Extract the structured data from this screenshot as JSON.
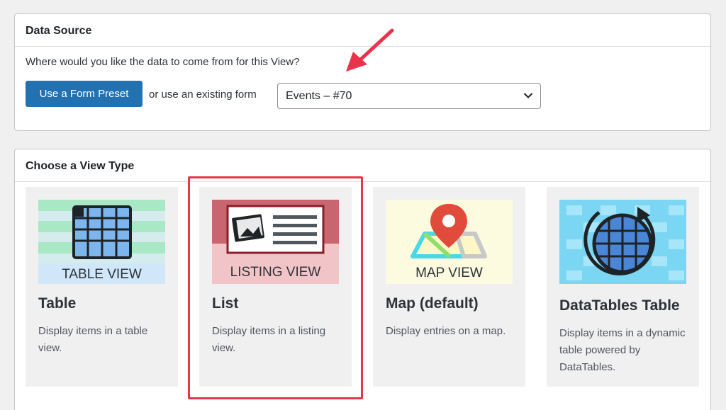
{
  "data_source": {
    "header": "Data Source",
    "question": "Where would you like the data to come from for this View?",
    "preset_button": "Use a Form Preset",
    "or_text": "or use an existing form",
    "selected_form": "Events – #70"
  },
  "view_type": {
    "header": "Choose a View Type",
    "cards": [
      {
        "title": "Table",
        "desc": "Display items in a table view.",
        "thumb_label": "TABLE VIEW"
      },
      {
        "title": "List",
        "desc": "Display items in a listing view.",
        "thumb_label": "LISTING VIEW"
      },
      {
        "title": "Map (default)",
        "desc": "Display entries on a map.",
        "thumb_label": "MAP VIEW"
      },
      {
        "title": "DataTables Table",
        "desc": "Display items in a dynamic table powered by DataTables."
      }
    ]
  },
  "colors": {
    "primary_button": "#2271b1",
    "highlight_border": "#e5364a",
    "annotation_arrow": "#e8334a"
  }
}
